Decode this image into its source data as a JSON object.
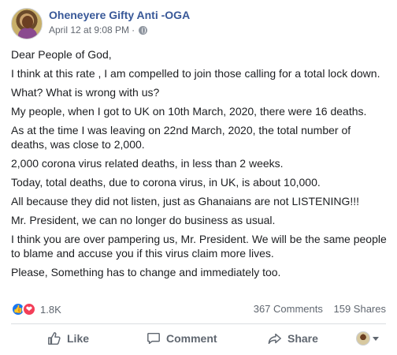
{
  "post": {
    "author": "Oheneyere Gifty Anti -OGA",
    "timestamp": "April 12 at 9:08 PM",
    "meta_separator": "·",
    "privacy_icon": "globe-icon",
    "paragraphs": [
      "Dear People of God,",
      "I think at this rate , I am compelled to join those calling for a total lock down.",
      "What? What is wrong with us?",
      "My people, when I got to UK on 10th March, 2020, there were 16 deaths.",
      "As at the time I was leaving on 22nd March, 2020, the total number of deaths, was close to 2,000.",
      "2,000 corona virus related deaths, in less than 2 weeks.",
      "Today, total deaths, due to corona virus, in UK, is about 10,000.",
      "All because they did not listen, just as Ghanaians are not LISTENING!!!",
      "Mr. President, we can no longer do business as usual.",
      "I think you are over pampering us, Mr. President. We will be the same people to blame and accuse you if this virus claim more lives.",
      "Please, Something has to change and immediately too."
    ]
  },
  "stats": {
    "reaction_count": "1.8K",
    "comments": "367 Comments",
    "shares": "159 Shares"
  },
  "actions": {
    "like": "Like",
    "comment": "Comment",
    "share": "Share"
  },
  "colors": {
    "author_link": "#385898",
    "like_blue": "#1877f2",
    "love_red": "#f33e58",
    "secondary_text": "#606770"
  }
}
